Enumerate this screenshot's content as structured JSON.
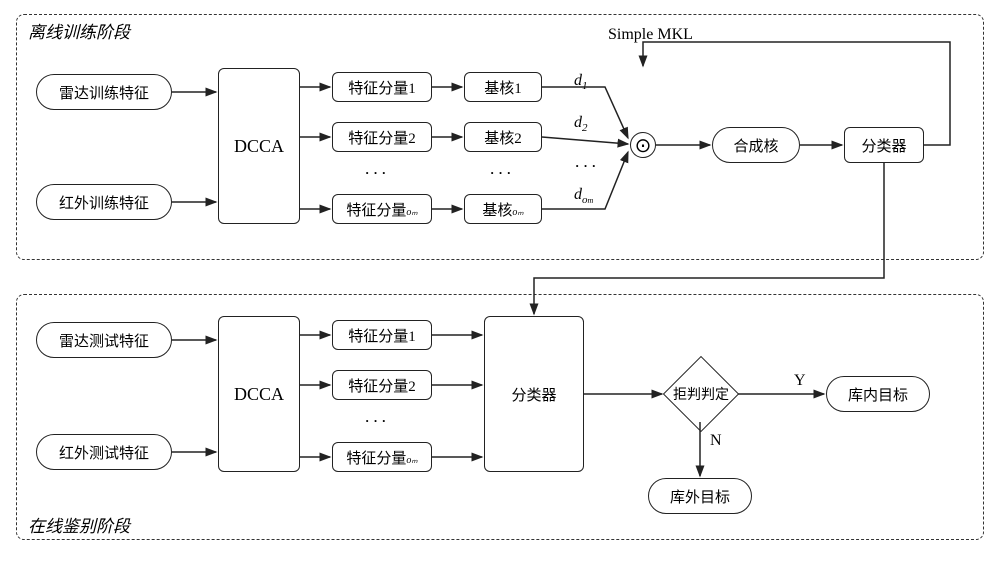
{
  "top": {
    "title": "离线训练阶段",
    "input1": "雷达训练特征",
    "input2": "红外训练特征",
    "dcca": "DCCA",
    "feat1": "特征分量1",
    "feat2": "特征分量2",
    "featM": "特征分量",
    "featM_sub": "oₘ",
    "kern1": "基核1",
    "kern2": "基核2",
    "kernM": "基核",
    "kernM_sub": "oₘ",
    "d1": "d₁",
    "d2": "d₂",
    "dM": "d",
    "dM_sub": "oₘ",
    "simplemkl": "Simple MKL",
    "combine": "合成核",
    "classifier": "分类器"
  },
  "bottom": {
    "title": "在线鉴别阶段",
    "input1": "雷达测试特征",
    "input2": "红外测试特征",
    "dcca": "DCCA",
    "feat1": "特征分量1",
    "feat2": "特征分量2",
    "featM": "特征分量",
    "featM_sub": "oₘ",
    "classifier": "分类器",
    "reject": "拒判判定",
    "yes": "Y",
    "no": "N",
    "in_lib": "库内目标",
    "out_lib": "库外目标"
  }
}
